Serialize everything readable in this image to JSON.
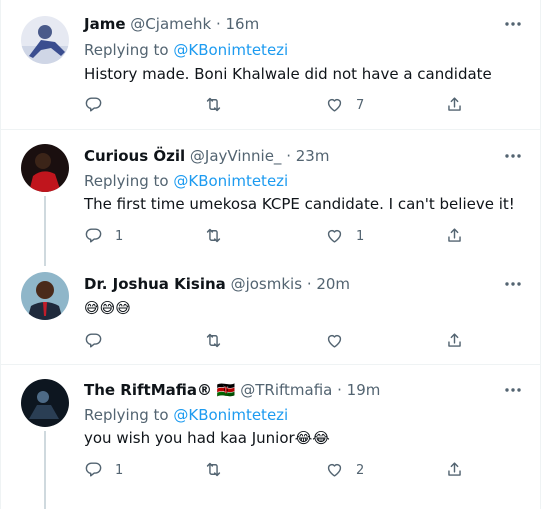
{
  "tweets": [
    {
      "name": "Jame",
      "handle": "@Cjamehk",
      "time": "· 16m",
      "replying_label": "Replying to",
      "replying_handle": "@KBonimtetezi",
      "text": "History made. Boni Khalwale did not have a candidate",
      "replies": "",
      "retweets": "",
      "likes": "7"
    },
    {
      "name": "Curious Özil",
      "handle": "@JayVinnie_",
      "time": "· 23m",
      "replying_label": "Replying to",
      "replying_handle": "@KBonimtetezi",
      "text": "The first time umekosa KCPE candidate. I can't believe it!",
      "replies": "1",
      "retweets": "",
      "likes": "1"
    },
    {
      "name": "Dr. Joshua Kisina",
      "handle": "@josmkis",
      "time": "· 20m",
      "text_emoji": "😅😅😅",
      "replies": "",
      "retweets": "",
      "likes": ""
    },
    {
      "name": "The RiftMafia®",
      "flag": "🇰🇪",
      "handle": "@TRiftmafia",
      "time": "· 19m",
      "replying_label": "Replying to",
      "replying_handle": "@KBonimtetezi",
      "text": "you wish you had kaa Junior",
      "text_emoji": "😂😂",
      "replies": "1",
      "retweets": "",
      "likes": "2"
    }
  ],
  "colors": {
    "link": "#1d9bf0",
    "muted": "#536471",
    "text": "#0f1419",
    "divider": "#eff3f4",
    "thread_line": "#cfd9de"
  },
  "icons": [
    "more-icon",
    "reply-icon",
    "retweet-icon",
    "like-icon",
    "share-icon"
  ]
}
